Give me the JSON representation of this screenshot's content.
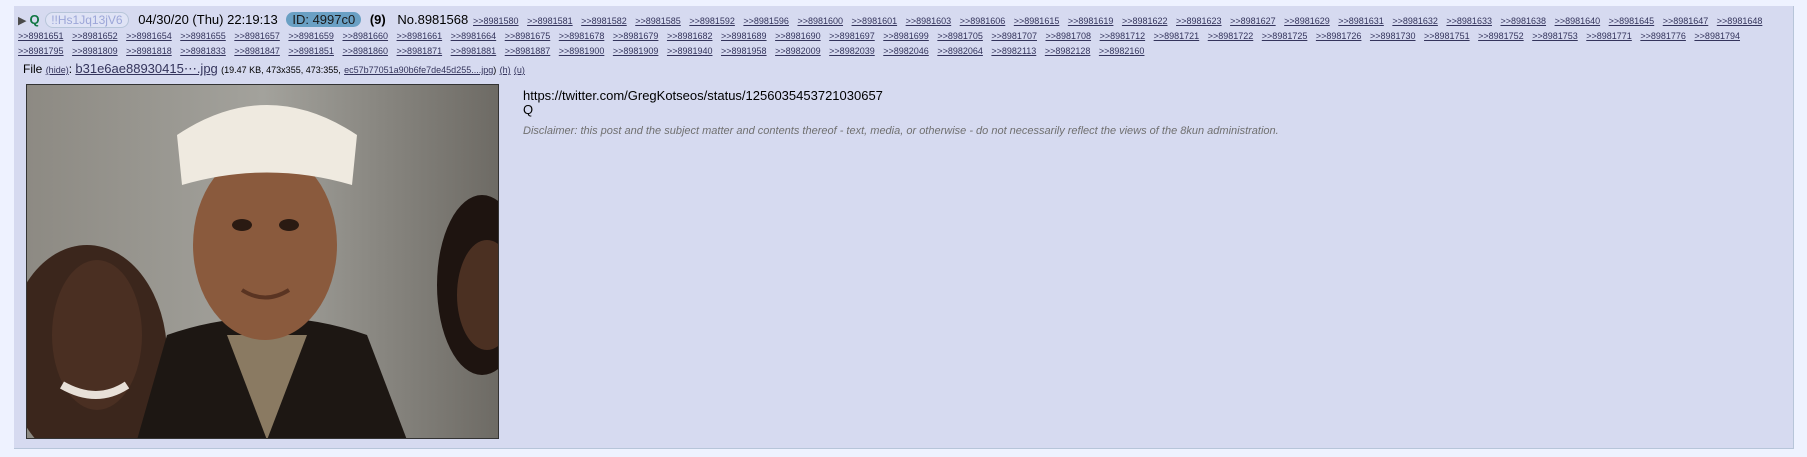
{
  "post": {
    "name": "Q",
    "tripcode": "!!Hs1Jq13jV6",
    "datetime": "04/30/20 (Thu) 22:19:13",
    "poster_id": "ID: 4997c0",
    "post_count": "(9)",
    "post_number": "No.8981568",
    "replies": [
      ">>8981580",
      ">>8981581",
      ">>8981582",
      ">>8981585",
      ">>8981592",
      ">>8981596",
      ">>8981600",
      ">>8981601",
      ">>8981603",
      ">>8981606",
      ">>8981615",
      ">>8981619",
      ">>8981622",
      ">>8981623",
      ">>8981627",
      ">>8981629",
      ">>8981631",
      ">>8981632",
      ">>8981633",
      ">>8981638",
      ">>8981640",
      ">>8981645",
      ">>8981647",
      ">>8981648",
      ">>8981651",
      ">>8981652",
      ">>8981654",
      ">>8981655",
      ">>8981657",
      ">>8981659",
      ">>8981660",
      ">>8981661",
      ">>8981664",
      ">>8981675",
      ">>8981678",
      ">>8981679",
      ">>8981682",
      ">>8981689",
      ">>8981690",
      ">>8981697",
      ">>8981699",
      ">>8981705",
      ">>8981707",
      ">>8981708",
      ">>8981712",
      ">>8981721",
      ">>8981722",
      ">>8981725",
      ">>8981726",
      ">>8981730",
      ">>8981751",
      ">>8981752",
      ">>8981753",
      ">>8981771",
      ">>8981776",
      ">>8981794",
      ">>8981795",
      ">>8981809",
      ">>8981818",
      ">>8981833",
      ">>8981847",
      ">>8981851",
      ">>8981860",
      ">>8981871",
      ">>8981881",
      ">>8981887",
      ">>8981900",
      ">>8981909",
      ">>8981940",
      ">>8981958",
      ">>8982009",
      ">>8982039",
      ">>8982046",
      ">>8982064",
      ">>8982113",
      ">>8982128",
      ">>8982160"
    ]
  },
  "file": {
    "label": "File",
    "hide_link": "(hide)",
    "filename": "b31e6ae88930415⋯.jpg",
    "meta": "(19.47 KB, 473x355, 473:355,",
    "original_name": "ec57b77051a90b6fe7de45d255....jpg",
    "meta_close": ")",
    "h_link": "(h)",
    "u_link": "(u)"
  },
  "body": {
    "line1": "https://twitter.com/GregKotseos/status/1256035453721030657",
    "line2": "Q",
    "disclaimer": "Disclaimer: this post and the subject matter and contents thereof - text, media, or otherwise - do not necessarily reflect the views of the 8kun administration."
  },
  "colors": {
    "post_bg": "#d6daf0",
    "page_bg": "#eef2ff",
    "name": "#117743",
    "link": "#34345c",
    "id_badge": "#6aa0c4"
  },
  "icons": {
    "collapse": "triangle-right-icon"
  }
}
